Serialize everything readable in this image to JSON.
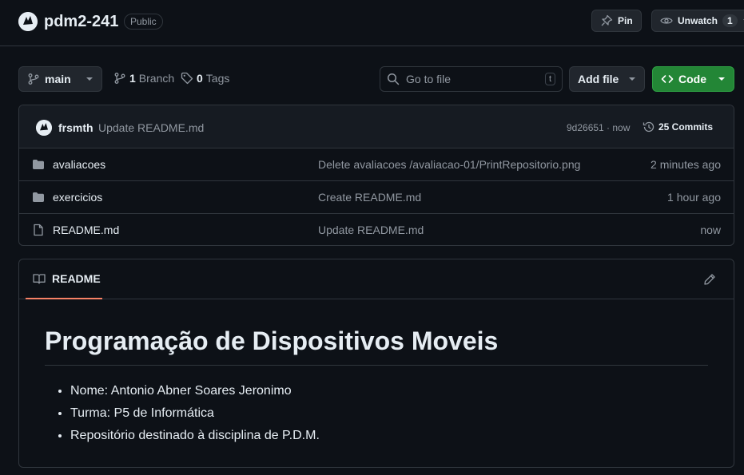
{
  "repo": {
    "name": "pdm2-241",
    "visibility": "Public",
    "pin_label": "Pin",
    "unwatch_label": "Unwatch",
    "watch_count": "1"
  },
  "toolbar": {
    "branch": "main",
    "branch_count": "1",
    "branch_label": "Branch",
    "tag_count": "0",
    "tag_label": "Tags",
    "search_placeholder": "Go to file",
    "search_shortcut": "t",
    "add_file_label": "Add file",
    "code_label": "Code"
  },
  "latest_commit": {
    "author": "frsmth",
    "message": "Update README.md",
    "hash_time": "9d26651 · now",
    "commits_label": "25 Commits"
  },
  "files": [
    {
      "name": "avaliacoes",
      "type": "folder",
      "commit": "Delete avaliacoes /avaliacao-01/PrintRepositorio.png",
      "time": "2 minutes ago"
    },
    {
      "name": "exercicios",
      "type": "folder",
      "commit": "Create README.md",
      "time": "1 hour ago"
    },
    {
      "name": "README.md",
      "type": "file",
      "commit": "Update README.md",
      "time": "now"
    }
  ],
  "readme": {
    "tab_label": "README",
    "title": "Programação de Dispositivos Moveis",
    "items": [
      "Nome: Antonio Abner Soares Jeronimo",
      "Turma: P5 de Informática",
      "Repositório destinado à disciplina de P.D.M."
    ]
  },
  "colors": {
    "background": "#0d1117",
    "border": "#30363d",
    "code_button": "#238636",
    "tab_underline": "#f78166",
    "muted_text": "#9198a1"
  }
}
